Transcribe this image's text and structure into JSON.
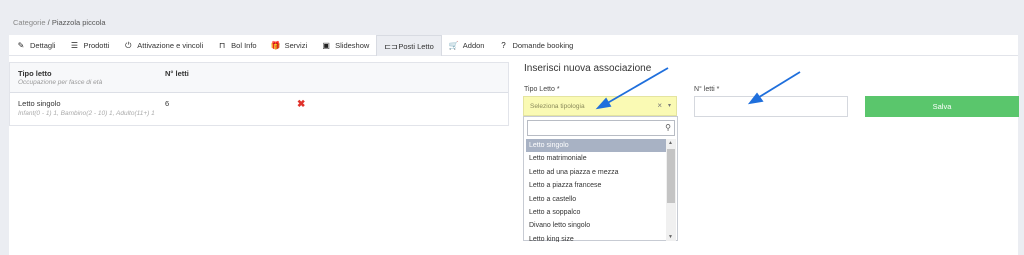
{
  "breadcrumb": {
    "parent": "Categorie",
    "separator": "/",
    "current": "Piazzola piccola"
  },
  "tabs": [
    {
      "label": "Dettagli",
      "icon": "edit-icon",
      "glyph": "✎"
    },
    {
      "label": "Prodotti",
      "icon": "list-icon",
      "glyph": "☰"
    },
    {
      "label": "Attivazione e vincoli",
      "icon": "power-icon",
      "glyph": "⏻"
    },
    {
      "label": "Bol Info",
      "icon": "bookmark-icon",
      "glyph": "⊓"
    },
    {
      "label": "Servizi",
      "icon": "gift-icon",
      "glyph": "🎁"
    },
    {
      "label": "Slideshow",
      "icon": "image-icon",
      "glyph": "▣"
    },
    {
      "label": "Posti Letto",
      "icon": "bed-icon",
      "glyph": "⊏⊐"
    },
    {
      "label": "Addon",
      "icon": "cart-icon",
      "glyph": "🛒"
    },
    {
      "label": "Domande booking",
      "icon": "question-icon",
      "glyph": "?"
    }
  ],
  "active_tab": "Posti Letto",
  "table": {
    "col1_header": "Tipo letto",
    "col1_subheader": "Occupazione per fasce di età",
    "col2_header": "N° letti",
    "rows": [
      {
        "type": "Letto singolo",
        "occupancy": "Infant(0 - 1) 1, Bambino(2 - 10) 1, Adulto(11+) 1",
        "count": "6",
        "delete_icon": "✖"
      }
    ]
  },
  "form": {
    "title": "Inserisci nuova associazione",
    "type_label": "Tipo Letto *",
    "type_placeholder": "Seleziona tipologia",
    "clear_glyph": "×",
    "caret_glyph": "▾",
    "count_label": "N° letti *",
    "count_value": "",
    "save_label": "Salva",
    "search_value": "",
    "search_glyph": "⚲"
  },
  "dropdown": {
    "options": [
      "Letto singolo",
      "Letto matrimoniale",
      "Letto ad una piazza e mezza",
      "Letto a piazza francese",
      "Letto a castello",
      "Letto a soppalco",
      "Divano letto singolo",
      "Letto king size"
    ],
    "highlighted": "Letto singolo"
  },
  "colors": {
    "accent_save": "#5ac66c",
    "select_bg": "#fafab4",
    "delete": "#e0322b",
    "highlight": "#a8b2c4",
    "arrow": "#1f6fdc"
  }
}
